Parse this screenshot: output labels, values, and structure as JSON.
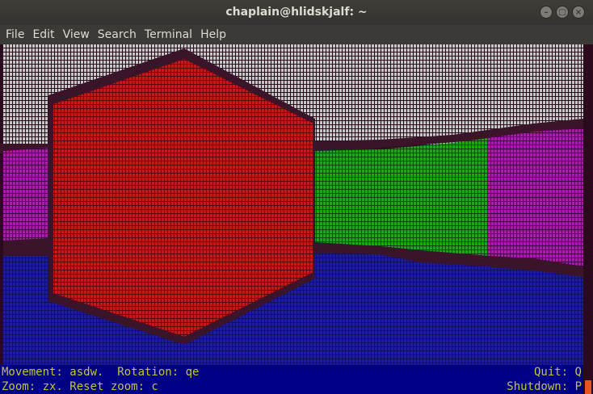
{
  "window": {
    "title": "chaplain@hlidskjalf: ~",
    "controls": {
      "minimize": "–",
      "maximize": "□",
      "close": "×"
    }
  },
  "menu": [
    "File",
    "Edit",
    "View",
    "Search",
    "Terminal",
    "Help"
  ],
  "terminal": {
    "glyph": "#",
    "colors": {
      "background": "#2c0a1e",
      "sky": "#c6c6c6",
      "floor": "#1c1c9f",
      "red_wall": "#c51818",
      "green_wall": "#1da51d",
      "magenta_wall": "#a81aa8",
      "shadow": "#3a1428",
      "status_bar": "#000087",
      "status_text": "#c4c43a",
      "cursor": "#e95420"
    },
    "status": {
      "line1_left": "Movement: asdw.  Rotation: qe",
      "line1_right": "Quit: Q",
      "line2_left": "Zoom: zx. Reset zoom: c",
      "line2_right": "Shutdown: P"
    }
  }
}
